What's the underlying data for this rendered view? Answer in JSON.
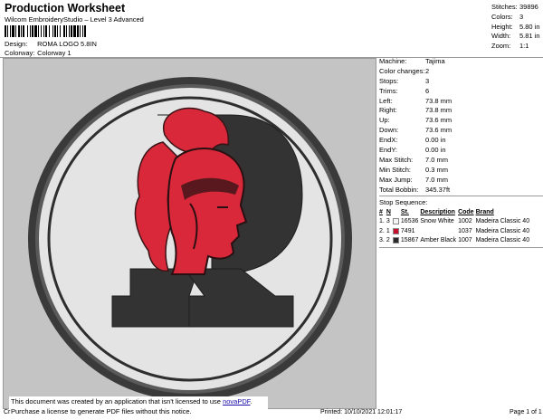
{
  "header": {
    "title": "Production Worksheet",
    "subtitle": "Wilcom EmbroideryStudio – Level 3 Advanced"
  },
  "meta": [
    {
      "key": "Design:",
      "value": "ROMA LOGO 5.8IN"
    },
    {
      "key": "Colorway:",
      "value": "Colorway 1"
    }
  ],
  "stats": [
    {
      "key": "Stitches:",
      "value": "39896"
    },
    {
      "key": "Colors:",
      "value": "3"
    },
    {
      "key": "Height:",
      "value": "5.80 in"
    },
    {
      "key": "Width:",
      "value": "5.81 in"
    },
    {
      "key": "Zoom:",
      "value": "1:1"
    }
  ],
  "machine": [
    {
      "key": "Machine:",
      "value": "Tajima"
    },
    {
      "key": "Color changes:",
      "value": "2"
    },
    {
      "key": "Stops:",
      "value": "3"
    },
    {
      "key": "Trims:",
      "value": "6"
    },
    {
      "key": "Left:",
      "value": "73.8 mm"
    },
    {
      "key": "Right:",
      "value": "73.8 mm"
    },
    {
      "key": "Up:",
      "value": "73.6 mm"
    },
    {
      "key": "Down:",
      "value": "73.6 mm"
    },
    {
      "key": "EndX:",
      "value": "0.00 in"
    },
    {
      "key": "EndY:",
      "value": "0.00 in"
    },
    {
      "key": "Max Stitch:",
      "value": "7.0 mm"
    },
    {
      "key": "Min Stitch:",
      "value": "0.3 mm"
    },
    {
      "key": "Max Jump:",
      "value": "7.0 mm"
    },
    {
      "key": "Total Bobbin:",
      "value": "345.37ft"
    }
  ],
  "stop_sequence": {
    "title": "Stop Sequence:",
    "headers": [
      "#",
      "N",
      "St.",
      "Description",
      "Code",
      "Brand"
    ],
    "rows": [
      {
        "num": "1.",
        "n": "3",
        "color": "#f4f4f4",
        "st": "16536",
        "desc": "Snow White",
        "code": "1002",
        "brand": "Madeira Classic 40"
      },
      {
        "num": "2.",
        "n": "1",
        "color": "#c8102e",
        "st": "7491",
        "desc": "",
        "code": "1037",
        "brand": "Madeira Classic 40"
      },
      {
        "num": "3.",
        "n": "2",
        "color": "#2b2b2b",
        "st": "15867",
        "desc": "Amber Black",
        "code": "1007",
        "brand": "Madeira Classic 40"
      }
    ]
  },
  "notice": {
    "line1": "This document was created by an application that isn't licensed to use ",
    "link": "novaPDF",
    "line1_end": ".",
    "line2": "Purchase a license to generate PDF files without this notice."
  },
  "footer": {
    "left": "Cr",
    "printed": "Printed: 10/10/2021 12:01:17",
    "page": "Page 1 of 1"
  },
  "colors": {
    "background": "#c4c4c4",
    "patch": "#e4e4e4",
    "border": "#3a3a3a",
    "dark": "#333333",
    "red": "#d8283a"
  }
}
